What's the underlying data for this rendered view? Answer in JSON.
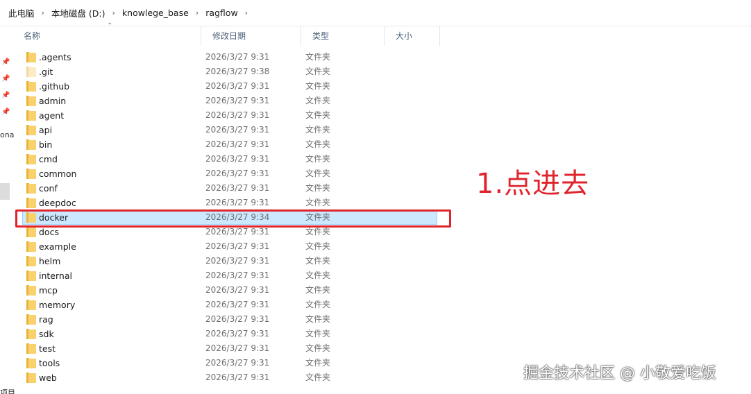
{
  "breadcrumb": [
    {
      "label": "此电脑"
    },
    {
      "label": "本地磁盘 (D:)"
    },
    {
      "label": "knowlege_base"
    },
    {
      "label": "ragflow"
    }
  ],
  "columns": {
    "name": "名称",
    "modified": "修改日期",
    "type": "类型",
    "size": "大小"
  },
  "left_pane": {
    "partial_label": "ona",
    "bottom_label": "项目"
  },
  "files": [
    {
      "name": ".agents",
      "modified": "2026/3/27 9:31",
      "type": "文件夹"
    },
    {
      "name": ".git",
      "modified": "2026/3/27 9:38",
      "type": "文件夹",
      "hidden": true
    },
    {
      "name": ".github",
      "modified": "2026/3/27 9:31",
      "type": "文件夹"
    },
    {
      "name": "admin",
      "modified": "2026/3/27 9:31",
      "type": "文件夹"
    },
    {
      "name": "agent",
      "modified": "2026/3/27 9:31",
      "type": "文件夹"
    },
    {
      "name": "api",
      "modified": "2026/3/27 9:31",
      "type": "文件夹"
    },
    {
      "name": "bin",
      "modified": "2026/3/27 9:31",
      "type": "文件夹"
    },
    {
      "name": "cmd",
      "modified": "2026/3/27 9:31",
      "type": "文件夹"
    },
    {
      "name": "common",
      "modified": "2026/3/27 9:31",
      "type": "文件夹"
    },
    {
      "name": "conf",
      "modified": "2026/3/27 9:31",
      "type": "文件夹"
    },
    {
      "name": "deepdoc",
      "modified": "2026/3/27 9:31",
      "type": "文件夹"
    },
    {
      "name": "docker",
      "modified": "2026/3/27 9:34",
      "type": "文件夹",
      "selected": true
    },
    {
      "name": "docs",
      "modified": "2026/3/27 9:31",
      "type": "文件夹"
    },
    {
      "name": "example",
      "modified": "2026/3/27 9:31",
      "type": "文件夹"
    },
    {
      "name": "helm",
      "modified": "2026/3/27 9:31",
      "type": "文件夹"
    },
    {
      "name": "internal",
      "modified": "2026/3/27 9:31",
      "type": "文件夹"
    },
    {
      "name": "mcp",
      "modified": "2026/3/27 9:31",
      "type": "文件夹"
    },
    {
      "name": "memory",
      "modified": "2026/3/27 9:31",
      "type": "文件夹"
    },
    {
      "name": "rag",
      "modified": "2026/3/27 9:31",
      "type": "文件夹"
    },
    {
      "name": "sdk",
      "modified": "2026/3/27 9:31",
      "type": "文件夹"
    },
    {
      "name": "test",
      "modified": "2026/3/27 9:31",
      "type": "文件夹"
    },
    {
      "name": "tools",
      "modified": "2026/3/27 9:31",
      "type": "文件夹"
    },
    {
      "name": "web",
      "modified": "2026/3/27 9:31",
      "type": "文件夹"
    }
  ],
  "annotation": {
    "text": "1.点进去",
    "color": "#e0242c"
  },
  "watermark": {
    "text": "掘金技术社区 @ 小敬爱吃饭"
  },
  "colors": {
    "selection_bg": "#cce8ff",
    "selection_border": "#99d1ff",
    "folder": "#f9d26f",
    "header_text": "#4c607a"
  },
  "icons": {
    "folder": "folder-icon",
    "pin": "pin-icon",
    "sort": "sort-up-icon",
    "separator": "chevron-right-icon"
  }
}
